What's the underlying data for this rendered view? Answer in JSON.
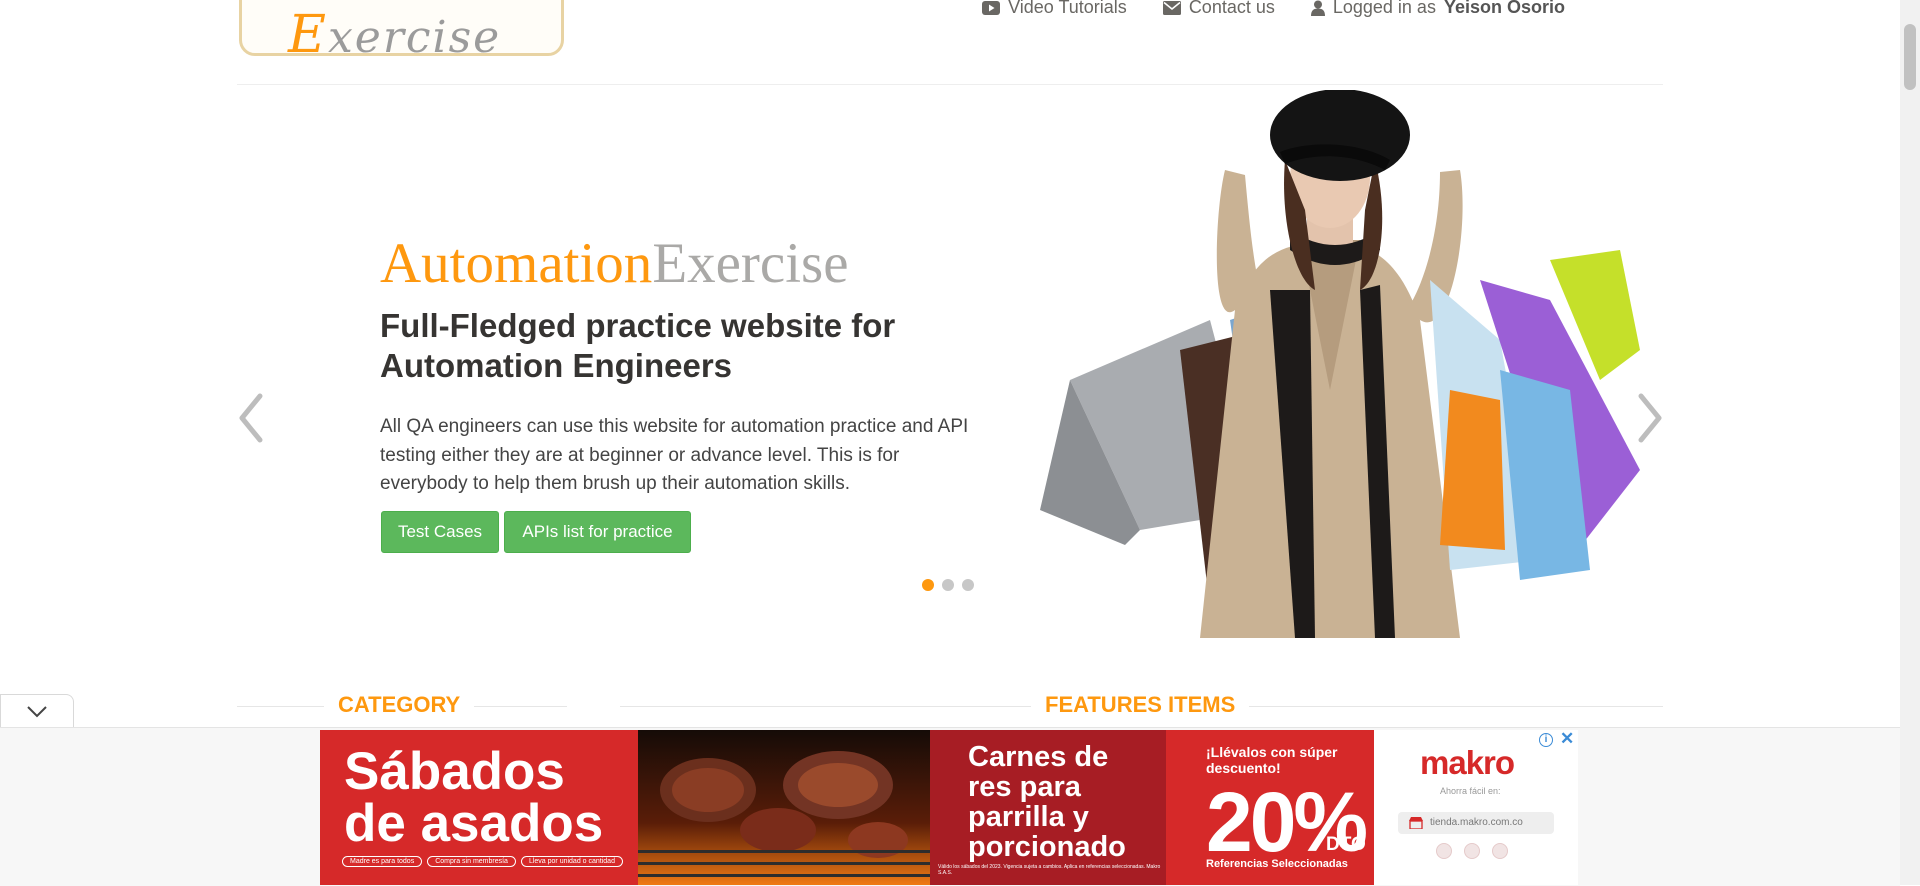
{
  "header": {
    "logo_text_first": "E",
    "logo_text_rest": "xercise",
    "nav": {
      "video_tutorials": "Video Tutorials",
      "contact_us": "Contact us",
      "logged_in_prefix": "Logged in as",
      "username": "Yeison Osorio"
    }
  },
  "slider": {
    "brand_part1": "Automation",
    "brand_part2": "Exercise",
    "subtitle": "Full-Fledged practice website for Automation Engineers",
    "description": "All QA engineers can use this website for automation practice and API testing either they are at beginner or advance level. This is for everybody to help them brush up their automation skills.",
    "btn_test_cases": "Test Cases",
    "btn_apis": "APIs list for practice",
    "active_slide": 1,
    "slide_count": 3
  },
  "sections": {
    "category": "CATEGORY",
    "features_items": "FEATURES ITEMS"
  },
  "ad": {
    "panel1_title": "Sábados de asados",
    "pill1": "Madre es para todos",
    "pill2": "Compra sin membresía",
    "pill3": "Lleva por unidad o cantidad",
    "panel3_title": "Carnes de res para parrilla y porcionado",
    "panel3_legal": "Válido los sábados del 2023. Vigencia sujeta a cambios. Aplica en referencias seleccionadas. Makro S.A.S.",
    "panel4_top": "¡Llévalos con súper descuento!",
    "panel4_percent": "20%",
    "panel4_dto": "DTO",
    "panel4_ref": "Referencias Seleccionadas",
    "brand": "makro",
    "tagline": "Ahorra fácil en:",
    "url": "tienda.makro.com.co",
    "colors": {
      "red": "#d62929",
      "dark_red": "#a71d24"
    }
  },
  "colors": {
    "accent_orange": "#fe980f",
    "button_green": "#5cb85c",
    "brand_gray": "#aaa9a7"
  }
}
